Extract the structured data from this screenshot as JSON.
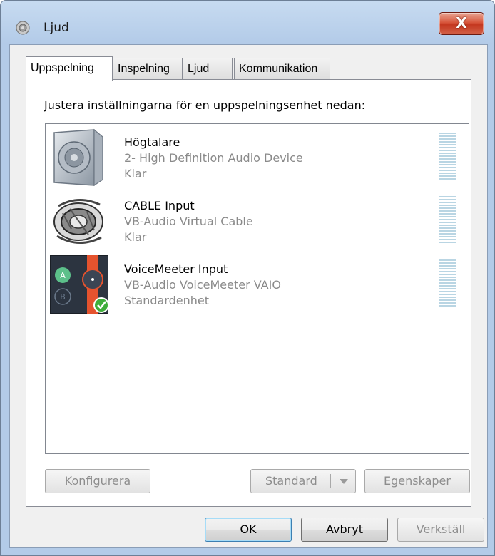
{
  "window": {
    "title": "Ljud",
    "close_glyph": "X",
    "icon": "speaker-icon"
  },
  "tabs": [
    {
      "label": "Uppspelning",
      "active": true
    },
    {
      "label": "Inspelning",
      "active": false
    },
    {
      "label": "Ljud",
      "active": false
    },
    {
      "label": "Kommunikation",
      "active": false
    }
  ],
  "panel": {
    "instruction": "Justera inställningarna för en uppspelningsenhet nedan:",
    "devices": [
      {
        "name": "Högtalare",
        "description": "2- High Definition Audio Device",
        "status": "Klar",
        "icon": "speaker-device-icon"
      },
      {
        "name": "CABLE Input",
        "description": "VB-Audio Virtual Cable",
        "status": "Klar",
        "icon": "cable-device-icon"
      },
      {
        "name": "VoiceMeeter Input",
        "description": "VB-Audio VoiceMeeter VAIO",
        "status": "Standardenhet",
        "icon": "voicemeeter-device-icon",
        "default": true
      }
    ],
    "buttons": {
      "configure": "Konfigurera",
      "standard": "Standard",
      "properties": "Egenskaper"
    }
  },
  "footer": {
    "ok": "OK",
    "cancel": "Avbryt",
    "apply": "Verkställ"
  },
  "colors": {
    "titlebar": "#b3cbe8",
    "close": "#c4371f",
    "meter": "#b9d5e3",
    "default_check": "#3fae3b"
  }
}
